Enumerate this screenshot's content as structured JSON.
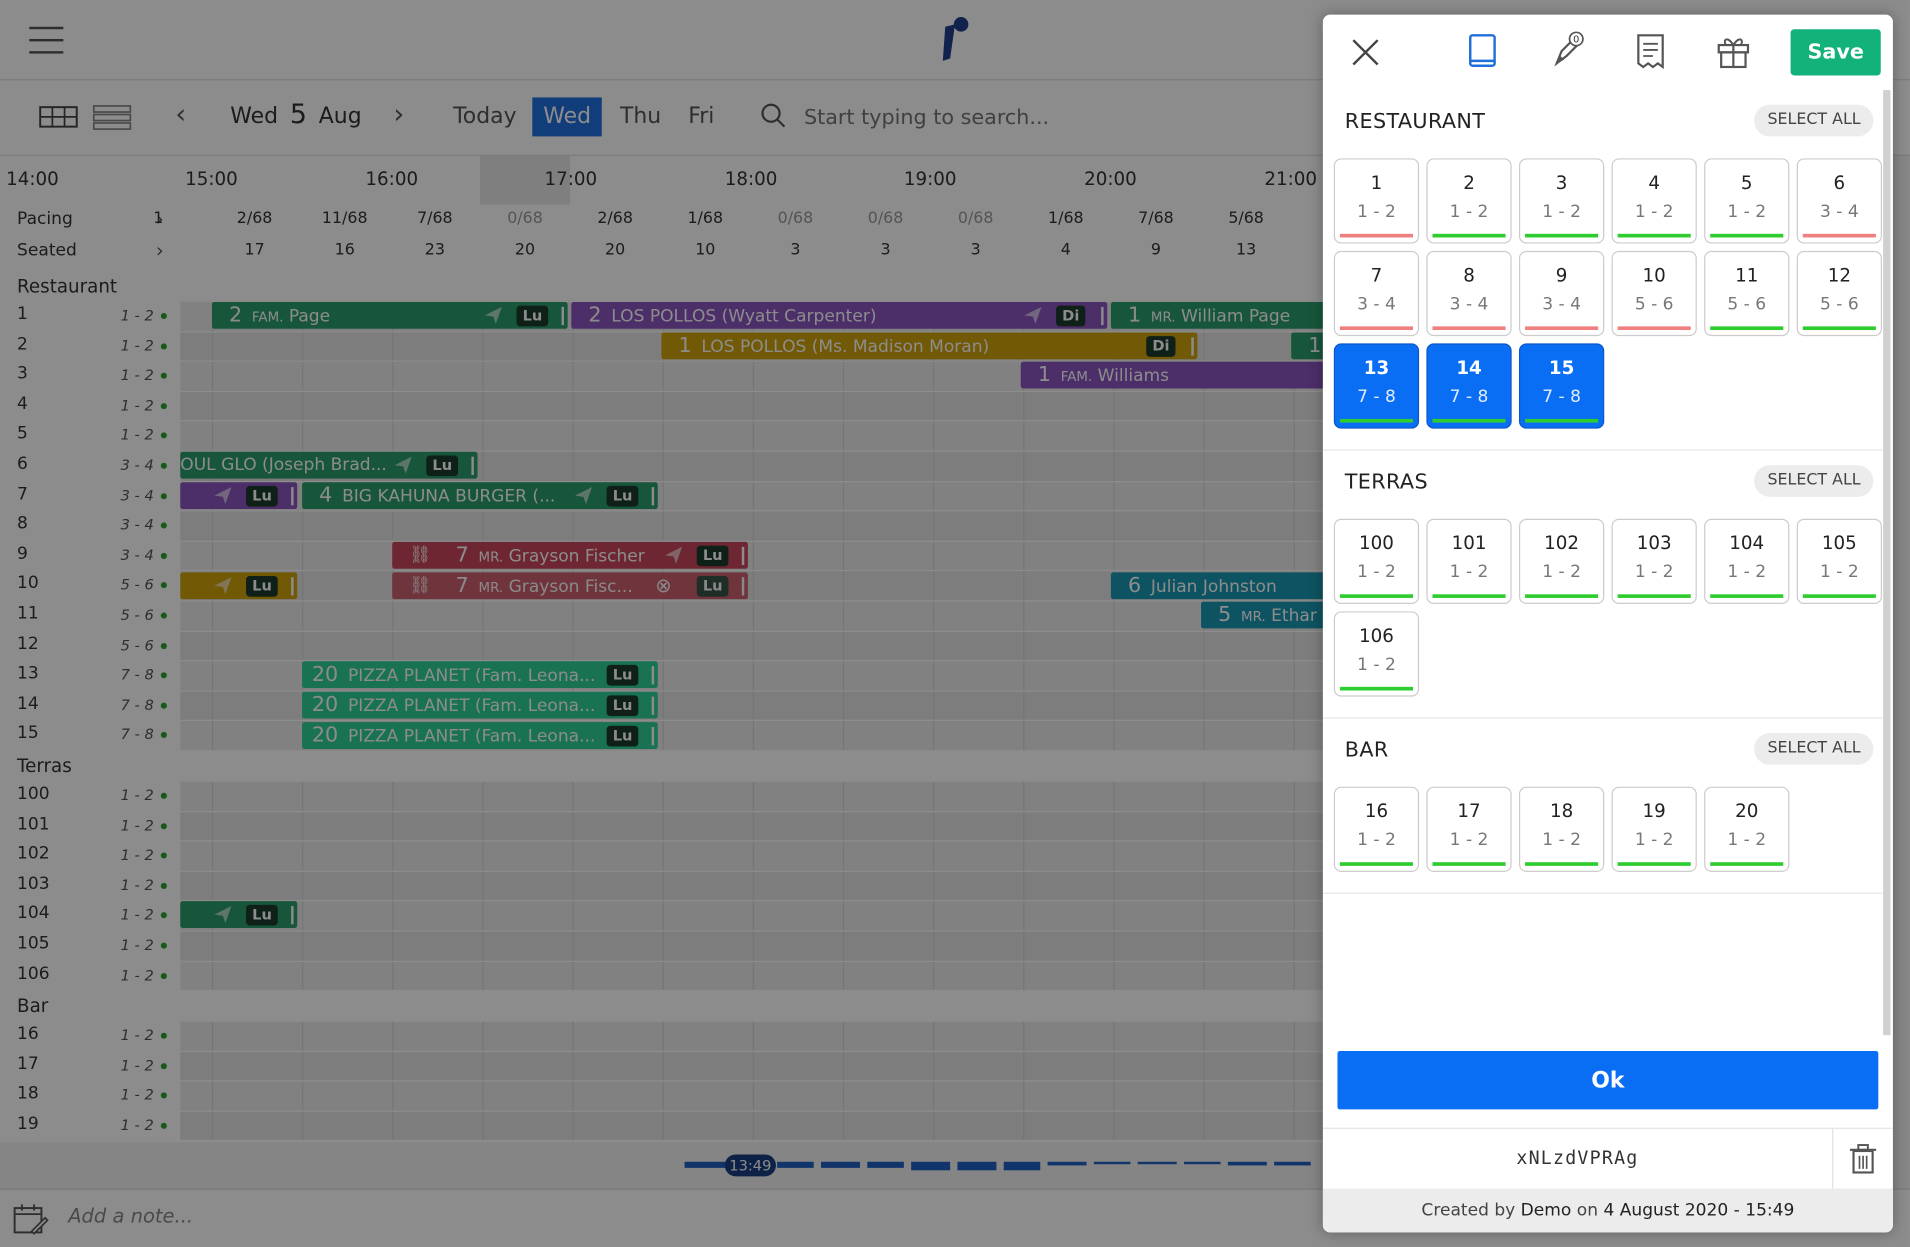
{
  "toolbar": {
    "weekday": "Wed",
    "day": "5",
    "month": "Aug",
    "tabs": [
      "Today",
      "Wed",
      "Thu",
      "Fri"
    ],
    "active_tab": "Wed",
    "search_placeholder": "Start typing to search..."
  },
  "timeline": {
    "hours": [
      "14:00",
      "15:00",
      "16:00",
      "17:00",
      "18:00",
      "19:00",
      "20:00",
      "21:00"
    ],
    "pacing_label": "Pacing",
    "seated_label": "Seated",
    "pacing_first": "1",
    "pacing": [
      "2/68",
      "11/68",
      "7/68",
      "0/68",
      "2/68",
      "1/68",
      "0/68",
      "0/68",
      "0/68",
      "1/68",
      "7/68",
      "5/68"
    ],
    "seated": [
      "17",
      "16",
      "23",
      "20",
      "20",
      "10",
      "3",
      "3",
      "3",
      "4",
      "9",
      "13"
    ],
    "sections": {
      "restaurant": "Restaurant",
      "terras": "Terras",
      "bar": "Bar"
    },
    "rows": [
      {
        "num": "1",
        "cap": "1 - 2"
      },
      {
        "num": "2",
        "cap": "1 - 2"
      },
      {
        "num": "3",
        "cap": "1 - 2"
      },
      {
        "num": "4",
        "cap": "1 - 2"
      },
      {
        "num": "5",
        "cap": "1 - 2"
      },
      {
        "num": "6",
        "cap": "3 - 4"
      },
      {
        "num": "7",
        "cap": "3 - 4"
      },
      {
        "num": "8",
        "cap": "3 - 4"
      },
      {
        "num": "9",
        "cap": "3 - 4"
      },
      {
        "num": "10",
        "cap": "5 - 6"
      },
      {
        "num": "11",
        "cap": "5 - 6"
      },
      {
        "num": "12",
        "cap": "5 - 6"
      },
      {
        "num": "13",
        "cap": "7 - 8"
      },
      {
        "num": "14",
        "cap": "7 - 8"
      },
      {
        "num": "15",
        "cap": "7 - 8"
      }
    ],
    "terras_rows": [
      {
        "num": "100",
        "cap": "1 - 2"
      },
      {
        "num": "101",
        "cap": "1 - 2"
      },
      {
        "num": "102",
        "cap": "1 - 2"
      },
      {
        "num": "103",
        "cap": "1 - 2"
      },
      {
        "num": "104",
        "cap": "1 - 2"
      },
      {
        "num": "105",
        "cap": "1 - 2"
      },
      {
        "num": "106",
        "cap": "1 - 2"
      }
    ],
    "bar_rows": [
      {
        "num": "16",
        "cap": "1 - 2"
      },
      {
        "num": "17",
        "cap": "1 - 2"
      },
      {
        "num": "18",
        "cap": "1 - 2"
      },
      {
        "num": "19",
        "cap": "1 - 2"
      }
    ],
    "reservations": {
      "r1": {
        "count": "2",
        "prefix": "FAM.",
        "name": "Page",
        "tag": "Lu"
      },
      "r2": {
        "count": "2",
        "name": "LOS POLLOS (Wyatt Carpenter)",
        "tag": "Di"
      },
      "r3": {
        "count": "1",
        "prefix": "MR.",
        "name": "William Page"
      },
      "r4": {
        "count": "1",
        "name": "LOS POLLOS (Ms. Madison Moran)",
        "tag": "Di"
      },
      "r4b": {
        "count": "1"
      },
      "r5": {
        "count": "1",
        "prefix": "FAM.",
        "name": "Williams"
      },
      "r6": {
        "name": "OUL GLO (Joseph Brad...",
        "tag": "Lu"
      },
      "r7": {
        "tag": "Lu"
      },
      "r8": {
        "count": "4",
        "name": "BIG KAHUNA BURGER (...",
        "tag": "Lu"
      },
      "r9": {
        "count": "7",
        "prefix": "MR.",
        "name": "Grayson Fischer",
        "tag": "Lu"
      },
      "r10": {
        "count": "7",
        "prefix": "MR.",
        "name": "Grayson Fisc...",
        "tag": "Lu"
      },
      "r11": {
        "tag": "Lu"
      },
      "r12": {
        "count": "6",
        "name": "Julian Johnston"
      },
      "r13": {
        "count": "5",
        "prefix": "MR.",
        "name": "Ethar"
      },
      "r14": {
        "count": "20",
        "name": "PIZZA PLANET (Fam. Leona...",
        "tag": "Lu"
      },
      "r15": {
        "count": "20",
        "name": "PIZZA PLANET (Fam. Leona...",
        "tag": "Lu"
      },
      "r16": {
        "count": "20",
        "name": "PIZZA PLANET (Fam. Leona...",
        "tag": "Lu"
      },
      "r17": {
        "tag": "Lu"
      }
    },
    "now_time": "13:49"
  },
  "note_placeholder": "Add a note...",
  "panel": {
    "save_label": "Save",
    "rocket_badge": "0",
    "select_all": "SELECT ALL",
    "areas": [
      {
        "title": "RESTAURANT",
        "tables": [
          {
            "n": "1",
            "c": "1 - 2",
            "line": "red"
          },
          {
            "n": "2",
            "c": "1 - 2",
            "line": "green"
          },
          {
            "n": "3",
            "c": "1 - 2",
            "line": "green"
          },
          {
            "n": "4",
            "c": "1 - 2",
            "line": "green"
          },
          {
            "n": "5",
            "c": "1 - 2",
            "line": "green"
          },
          {
            "n": "6",
            "c": "3 - 4",
            "line": "red"
          },
          {
            "n": "7",
            "c": "3 - 4",
            "line": "red"
          },
          {
            "n": "8",
            "c": "3 - 4",
            "line": "red"
          },
          {
            "n": "9",
            "c": "3 - 4",
            "line": "red"
          },
          {
            "n": "10",
            "c": "5 - 6",
            "line": "red"
          },
          {
            "n": "11",
            "c": "5 - 6",
            "line": "green"
          },
          {
            "n": "12",
            "c": "5 - 6",
            "line": "green"
          },
          {
            "n": "13",
            "c": "7 - 8",
            "line": "green",
            "sel": true
          },
          {
            "n": "14",
            "c": "7 - 8",
            "line": "green",
            "sel": true
          },
          {
            "n": "15",
            "c": "7 - 8",
            "line": "green",
            "sel": true
          }
        ]
      },
      {
        "title": "TERRAS",
        "tables": [
          {
            "n": "100",
            "c": "1 - 2",
            "line": "green"
          },
          {
            "n": "101",
            "c": "1 - 2",
            "line": "green"
          },
          {
            "n": "102",
            "c": "1 - 2",
            "line": "green"
          },
          {
            "n": "103",
            "c": "1 - 2",
            "line": "green"
          },
          {
            "n": "104",
            "c": "1 - 2",
            "line": "green"
          },
          {
            "n": "105",
            "c": "1 - 2",
            "line": "green"
          },
          {
            "n": "106",
            "c": "1 - 2",
            "line": "green"
          }
        ]
      },
      {
        "title": "BAR",
        "tables": [
          {
            "n": "16",
            "c": "1 - 2",
            "line": "green"
          },
          {
            "n": "17",
            "c": "1 - 2",
            "line": "green"
          },
          {
            "n": "18",
            "c": "1 - 2",
            "line": "green"
          },
          {
            "n": "19",
            "c": "1 - 2",
            "line": "green"
          },
          {
            "n": "20",
            "c": "1 - 2",
            "line": "green"
          }
        ]
      }
    ],
    "ok_label": "Ok",
    "code": "xNLzdVPRAg",
    "created_prefix": "Created by",
    "created_by": "Demo",
    "created_on": "on",
    "created_date": "4 August 2020 - 15:49"
  }
}
